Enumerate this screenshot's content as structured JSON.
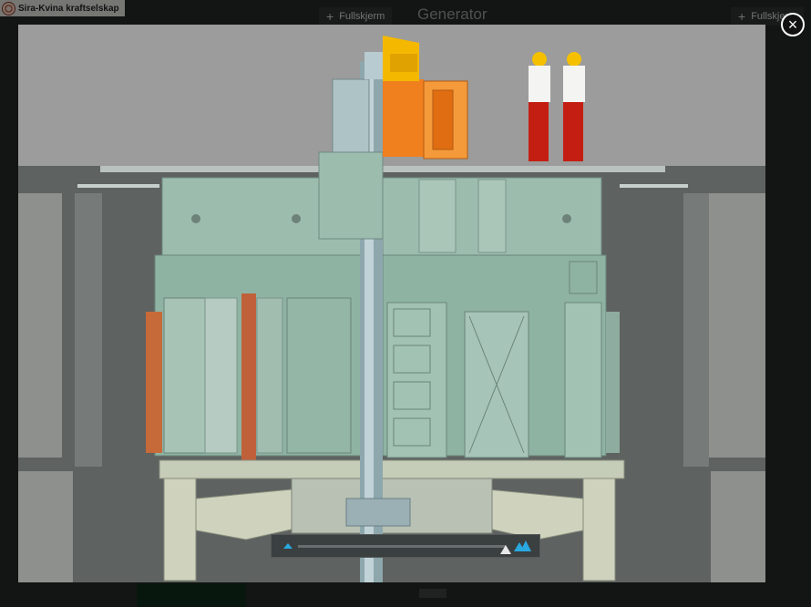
{
  "background": {
    "logo_text": "Sira-Kvina kraftselskap",
    "fullscreen_label_left": "Fullskjerm",
    "fullscreen_label_right": "Fullskjerm",
    "section_title": "Generator"
  },
  "lightbox": {
    "close_glyph": "×",
    "image_subject": "generator-cross-section",
    "zoom_level": 0.95
  },
  "icons": {
    "close": "close-icon",
    "plus": "plus-icon",
    "zoom_out": "zoom-out-icon",
    "zoom_in": "zoom-in-icon"
  },
  "colors": {
    "accent": "#2aa8e0",
    "machine_body": "#8fb3a3",
    "exciter_orange": "#f07f1e",
    "pit_walls": "#6b6f6d"
  }
}
